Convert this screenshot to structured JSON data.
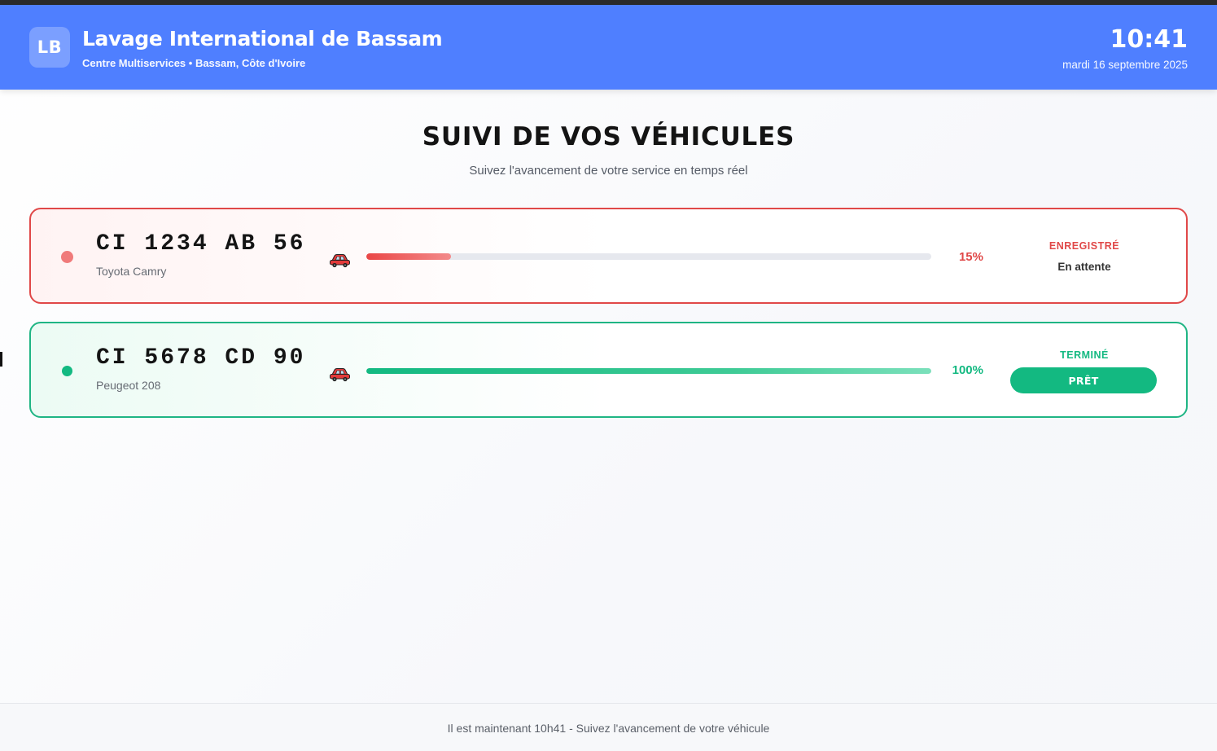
{
  "header": {
    "logo_text": "LB",
    "title": "Lavage International de Bassam",
    "subtitle": "Centre Multiservices • Bassam, Côte d'Ivoire",
    "time": "10:41",
    "date": "mardi 16 septembre 2025",
    "color": "#4f7fff"
  },
  "main": {
    "title": "SUIVI DE VOS VÉHICULES",
    "subtitle": "Suivez l'avancement de votre service en temps réel"
  },
  "vehicles": [
    {
      "plate": "CI 1234 AB 56",
      "model": "Toyota Camry",
      "icon": "car-icon",
      "progress": 15,
      "progress_label": "15%",
      "status_label": "ENREGISTRÉ",
      "status_text": "En attente",
      "color": "#e04848"
    },
    {
      "plate": "CI 5678 CD 90",
      "model": "Peugeot 208",
      "icon": "car-icon",
      "progress": 100,
      "progress_label": "100%",
      "status_label": "TERMINÉ",
      "button_label": "PRÊT",
      "color": "#13b981"
    }
  ],
  "footer": {
    "text": "Il est maintenant 10h41 - Suivez l'avancement de votre véhicule"
  }
}
